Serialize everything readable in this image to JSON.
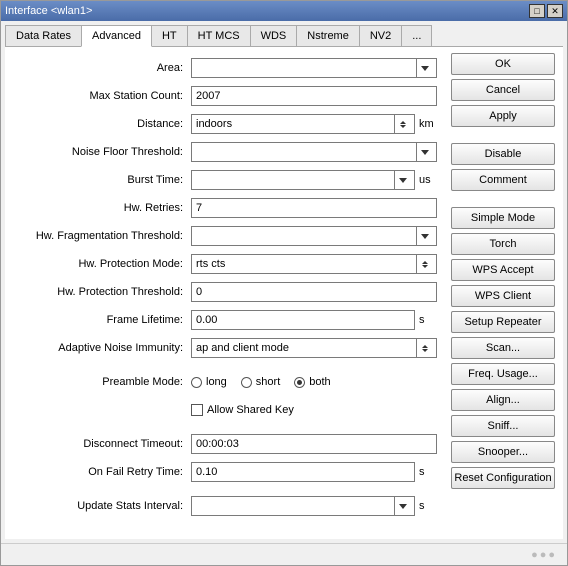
{
  "window": {
    "title": "Interface <wlan1>"
  },
  "tabs": {
    "data_rates": "Data Rates",
    "advanced": "Advanced",
    "ht": "HT",
    "ht_mcs": "HT MCS",
    "wds": "WDS",
    "nstreme": "Nstreme",
    "nv2": "NV2",
    "more": "..."
  },
  "labels": {
    "area": "Area:",
    "max_station_count": "Max Station Count:",
    "distance": "Distance:",
    "noise_floor_threshold": "Noise Floor Threshold:",
    "burst_time": "Burst Time:",
    "hw_retries": "Hw. Retries:",
    "hw_frag_threshold": "Hw. Fragmentation Threshold:",
    "hw_protection_mode": "Hw. Protection Mode:",
    "hw_protection_threshold": "Hw. Protection Threshold:",
    "frame_lifetime": "Frame Lifetime:",
    "adaptive_noise_immunity": "Adaptive Noise Immunity:",
    "preamble_mode": "Preamble Mode:",
    "allow_shared_key": "Allow Shared Key",
    "disconnect_timeout": "Disconnect Timeout:",
    "on_fail_retry_time": "On Fail Retry Time:",
    "update_stats_interval": "Update Stats Interval:"
  },
  "values": {
    "area": "",
    "max_station_count": "2007",
    "distance": "indoors",
    "noise_floor_threshold": "",
    "burst_time": "",
    "hw_retries": "7",
    "hw_frag_threshold": "",
    "hw_protection_mode": "rts cts",
    "hw_protection_threshold": "0",
    "frame_lifetime": "0.00",
    "adaptive_noise_immunity": "ap and client mode",
    "disconnect_timeout": "00:00:03",
    "on_fail_retry_time": "0.10",
    "update_stats_interval": ""
  },
  "units": {
    "km": "km",
    "us": "us",
    "s": "s"
  },
  "preamble": {
    "long": "long",
    "short": "short",
    "both": "both",
    "selected": "both"
  },
  "buttons": {
    "ok": "OK",
    "cancel": "Cancel",
    "apply": "Apply",
    "disable": "Disable",
    "comment": "Comment",
    "simple_mode": "Simple Mode",
    "torch": "Torch",
    "wps_accept": "WPS Accept",
    "wps_client": "WPS Client",
    "setup_repeater": "Setup Repeater",
    "scan": "Scan...",
    "freq_usage": "Freq. Usage...",
    "align": "Align...",
    "sniff": "Sniff...",
    "snooper": "Snooper...",
    "reset_config": "Reset Configuration"
  }
}
